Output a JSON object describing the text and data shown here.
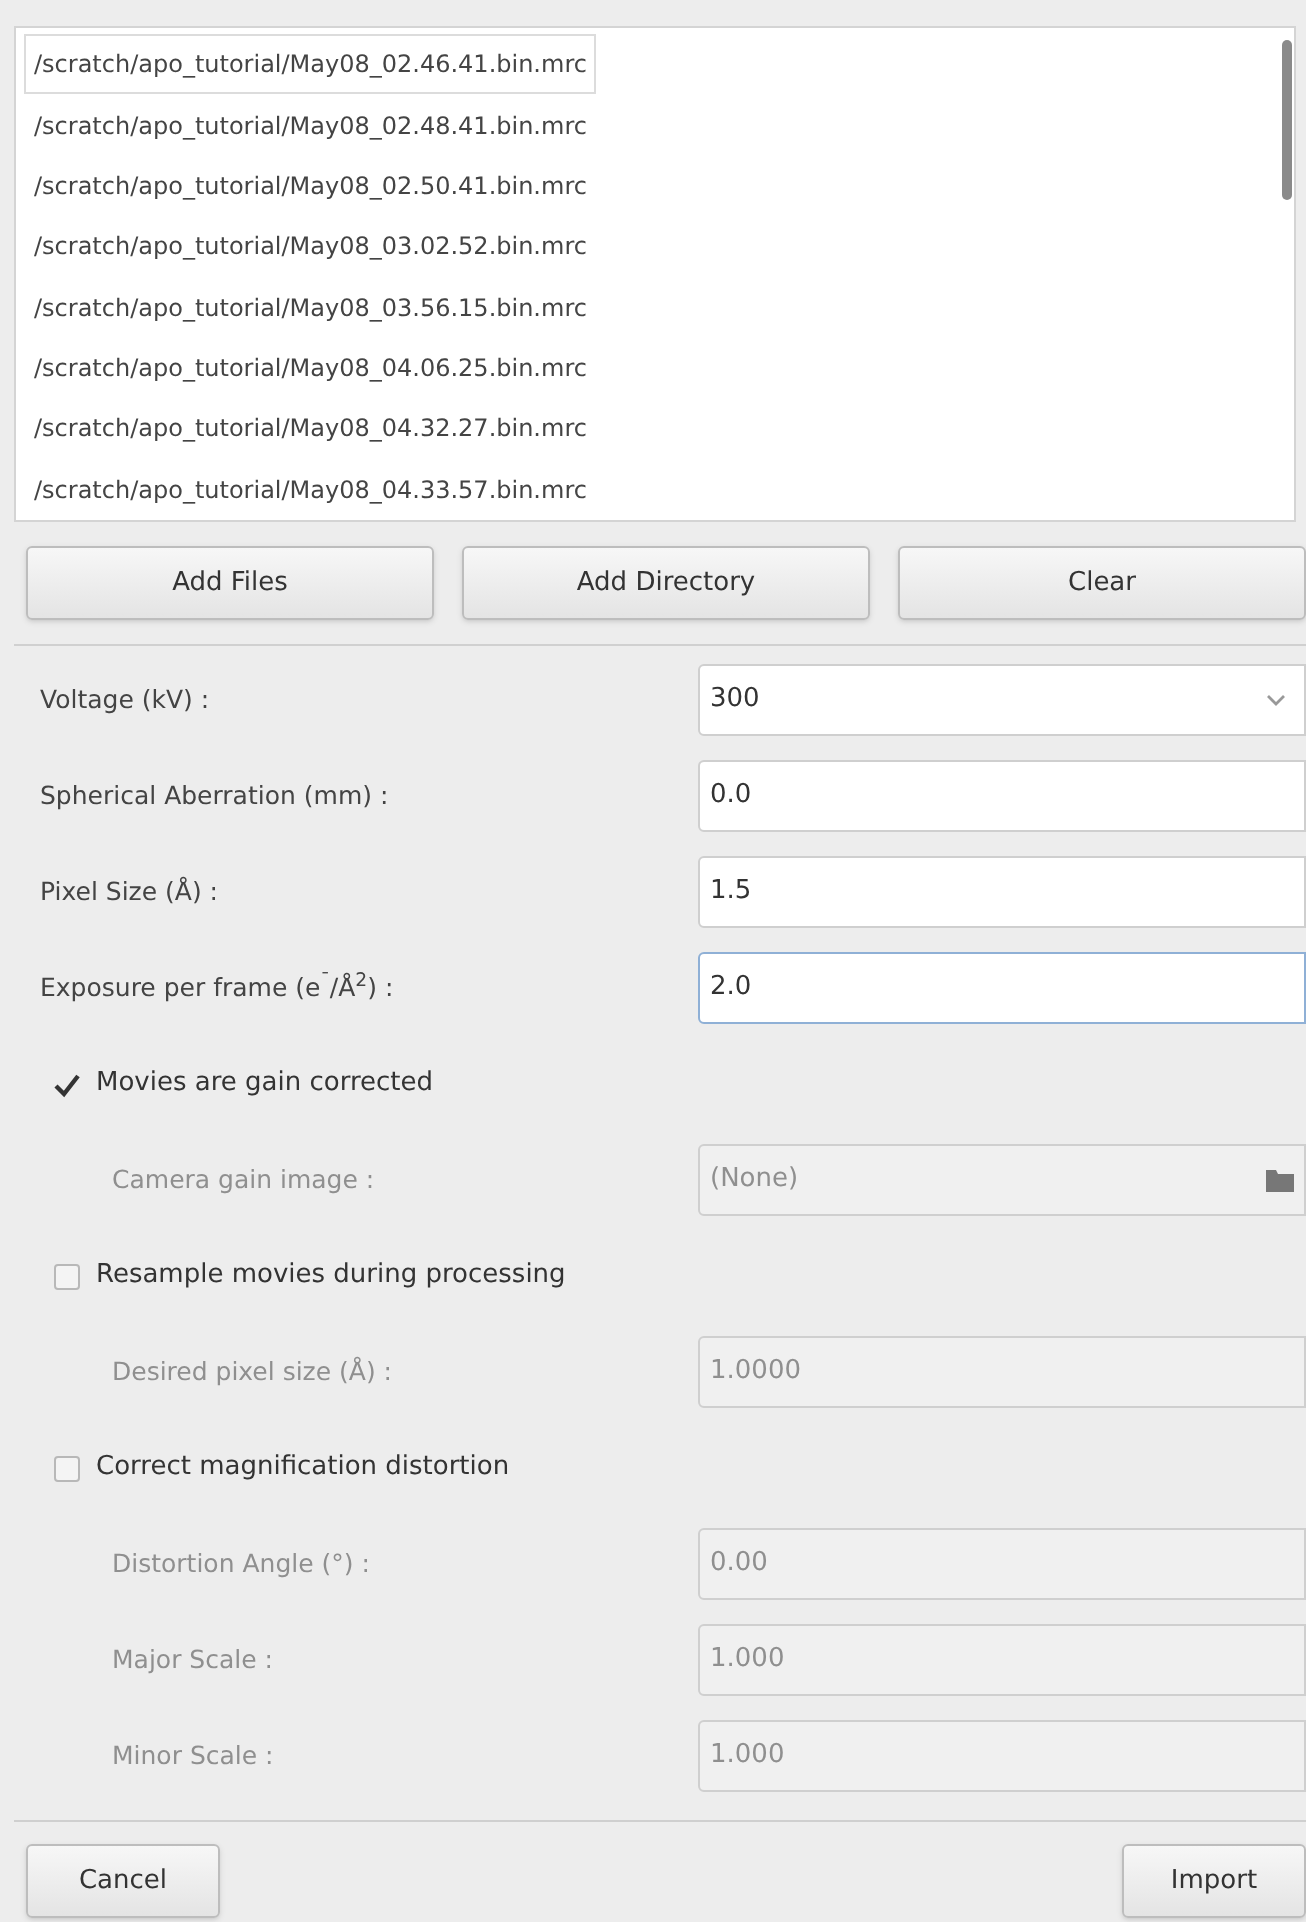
{
  "files": [
    {
      "path": "/scratch/apo_tutorial/May08_02.46.41.bin.mrc",
      "selected": true
    },
    {
      "path": "/scratch/apo_tutorial/May08_02.48.41.bin.mrc",
      "selected": false
    },
    {
      "path": "/scratch/apo_tutorial/May08_02.50.41.bin.mrc",
      "selected": false
    },
    {
      "path": "/scratch/apo_tutorial/May08_03.02.52.bin.mrc",
      "selected": false
    },
    {
      "path": "/scratch/apo_tutorial/May08_03.56.15.bin.mrc",
      "selected": false
    },
    {
      "path": "/scratch/apo_tutorial/May08_04.06.25.bin.mrc",
      "selected": false
    },
    {
      "path": "/scratch/apo_tutorial/May08_04.32.27.bin.mrc",
      "selected": false
    },
    {
      "path": "/scratch/apo_tutorial/May08_04.33.57.bin.mrc",
      "selected": false
    }
  ],
  "file_buttons": [
    "Add Files",
    "Add Directory",
    "Clear"
  ],
  "form": [
    {
      "kind": "combo",
      "label": "Voltage (kV) :",
      "value": "300",
      "disabled": false,
      "focused": false
    },
    {
      "kind": "text",
      "label": "Spherical Aberration (mm) :",
      "value": "0.0",
      "disabled": false,
      "focused": false
    },
    {
      "kind": "text",
      "label": "Pixel Size (Å) :",
      "value": "1.5",
      "disabled": false,
      "focused": false
    },
    {
      "kind": "text",
      "label": "Exposure per frame (e$^{¯}$/Å$^{2}$) :",
      "value": "2.0",
      "disabled": false,
      "focused": true
    },
    {
      "kind": "checkbox",
      "label": "Movies are gain corrected",
      "checked": true
    },
    {
      "kind": "file",
      "label": "Camera gain image :",
      "value": "(None)",
      "disabled": true,
      "focused": false
    },
    {
      "kind": "checkbox",
      "label": "Resample movies during processing",
      "checked": false
    },
    {
      "kind": "text",
      "label": "Desired pixel size (Å) :",
      "value": "1.0000",
      "disabled": true,
      "focused": false
    },
    {
      "kind": "checkbox",
      "label": "Correct magnification distortion",
      "checked": false
    },
    {
      "kind": "text",
      "label": "Distortion Angle (°) :",
      "value": "0.00",
      "disabled": true,
      "focused": false
    },
    {
      "kind": "text",
      "label": "Major Scale :",
      "value": "1.000",
      "disabled": true,
      "focused": false
    },
    {
      "kind": "text",
      "label": "Minor Scale :",
      "value": "1.000",
      "disabled": true,
      "focused": false
    }
  ],
  "actions": {
    "cancel": "Cancel",
    "import": "Import"
  }
}
